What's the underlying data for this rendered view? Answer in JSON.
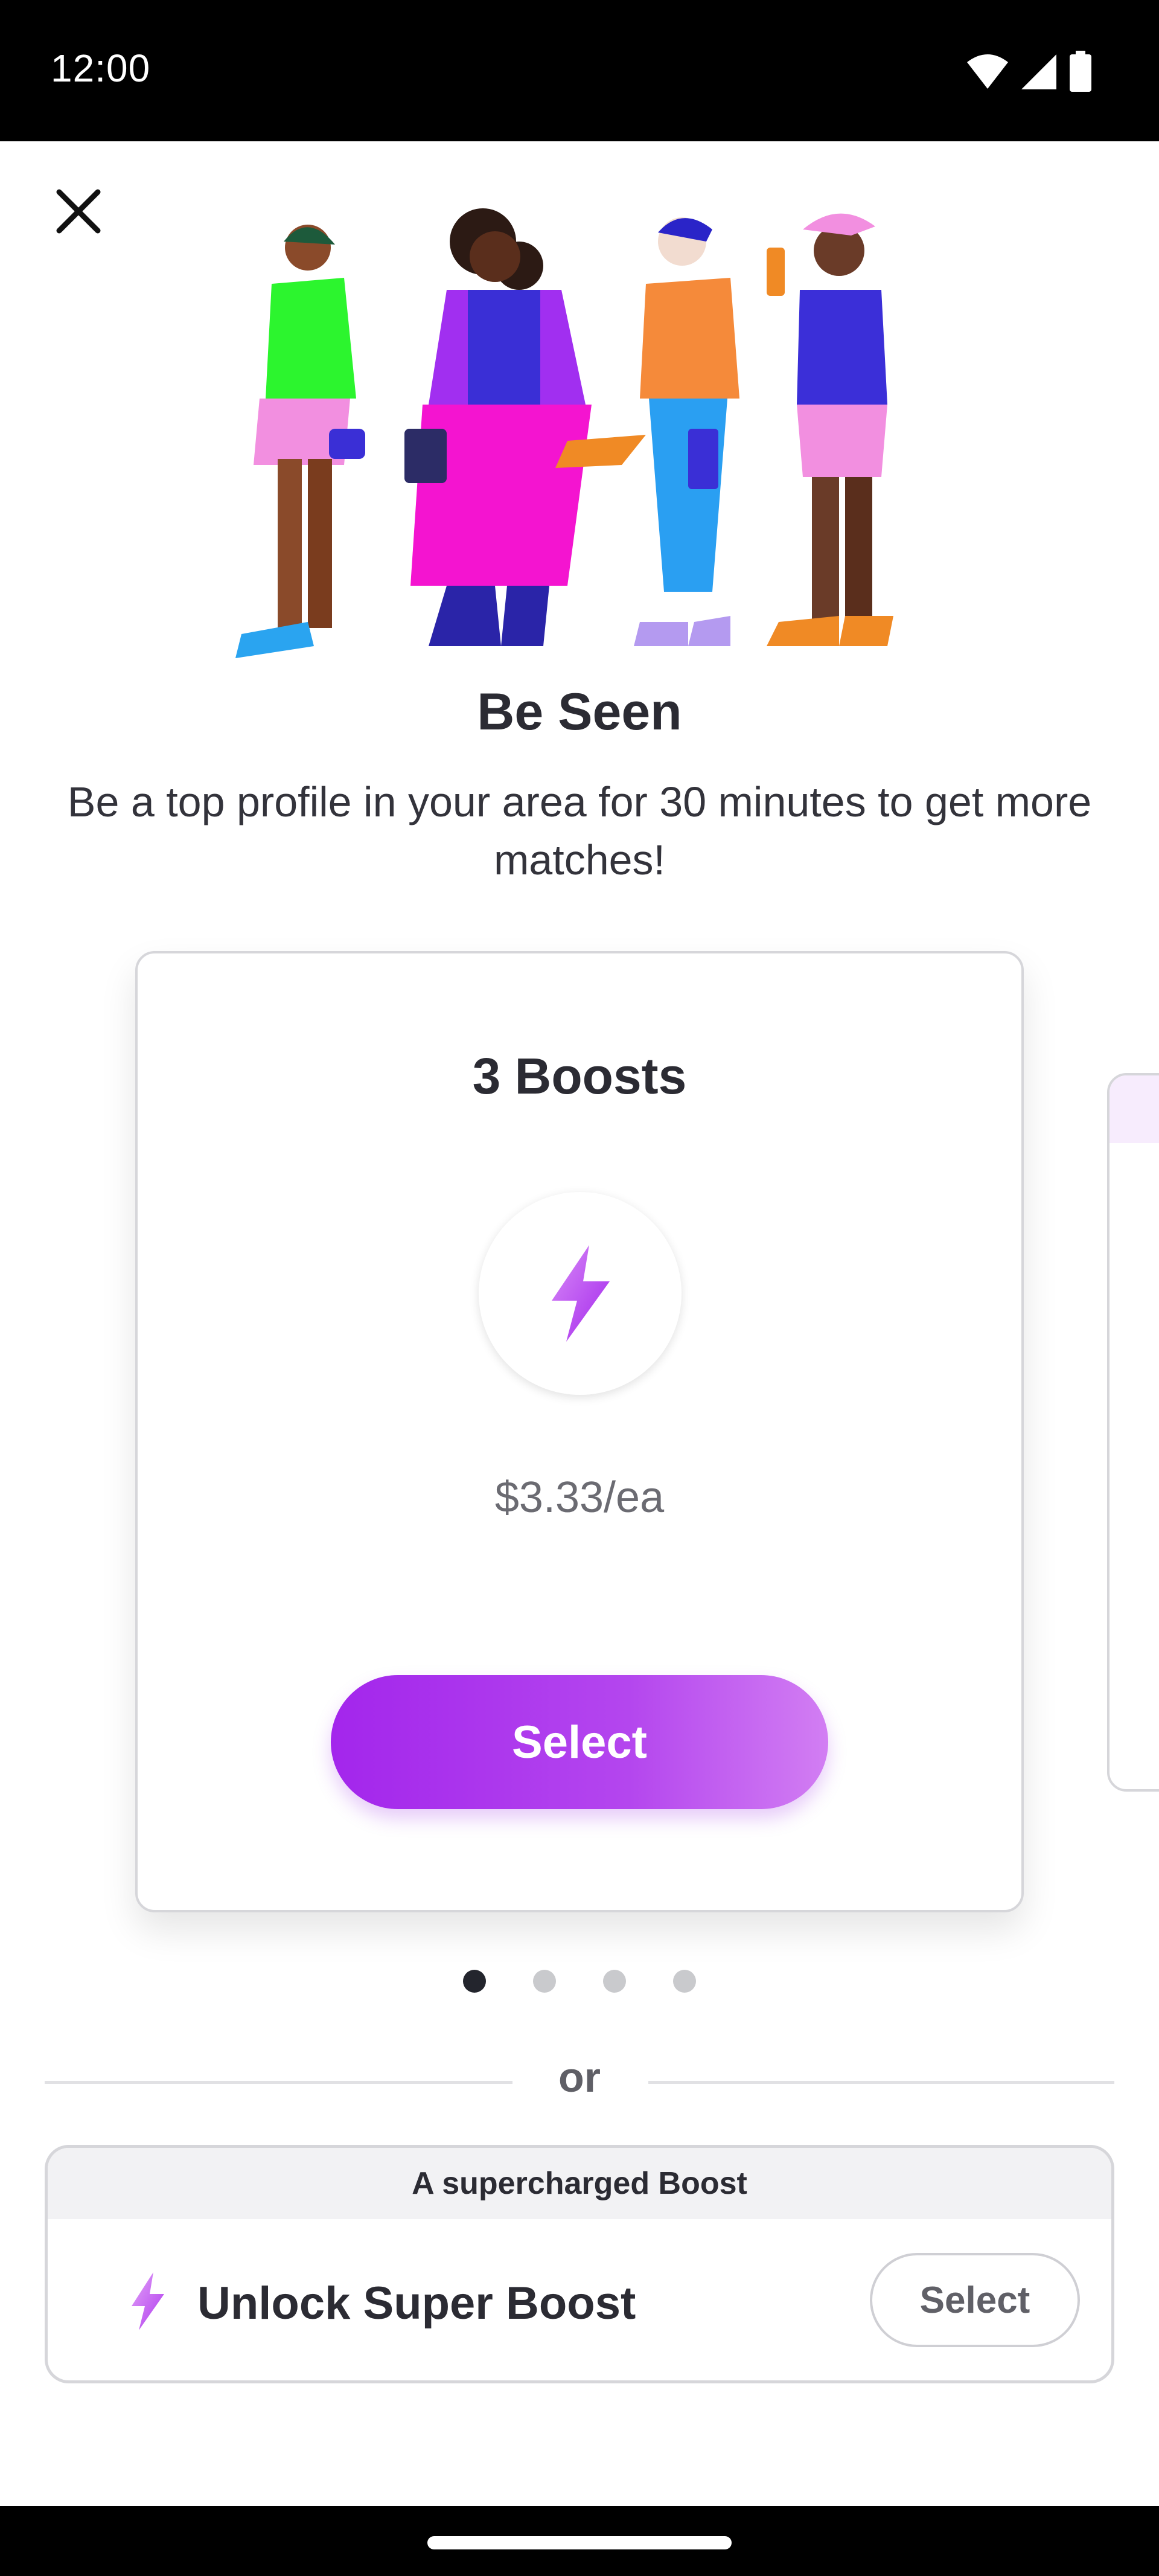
{
  "status_bar": {
    "time": "12:00",
    "icons": [
      "wifi-icon",
      "cellular-signal-icon",
      "battery-icon"
    ]
  },
  "header": {
    "close_icon": "close-icon"
  },
  "hero": {
    "title": "Be Seen",
    "subtitle": "Be a top profile in your area for 30 minutes to get more matches!"
  },
  "boost_card": {
    "title": "3 Boosts",
    "icon": "lightning-bolt-icon",
    "price": "$3.33/ea",
    "select_label": "Select"
  },
  "pagination": {
    "total": 4,
    "active_index": 0
  },
  "divider": {
    "or_label": "or"
  },
  "super_boost": {
    "header": "A supercharged Boost",
    "label": "Unlock Super Boost",
    "icon": "lightning-bolt-icon",
    "select_label": "Select"
  },
  "colors": {
    "accent": "#a326ec",
    "accent_light": "#d27ef3",
    "text": "#2b2b33",
    "muted": "#6b6b72"
  }
}
